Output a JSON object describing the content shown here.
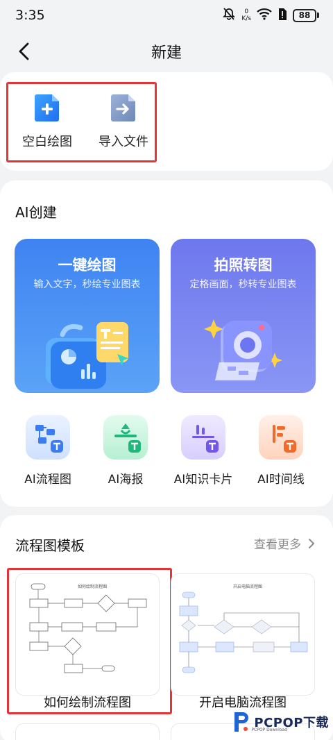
{
  "status": {
    "time": "3:35",
    "net_value": "0",
    "net_unit": "K/s",
    "battery": "88"
  },
  "nav": {
    "title": "新建"
  },
  "quick_actions": [
    {
      "label": "空白绘图",
      "icon": "blank-file-plus-icon"
    },
    {
      "label": "导入文件",
      "icon": "import-file-arrow-icon"
    }
  ],
  "ai_section": {
    "title": "AI创建",
    "cards": [
      {
        "title": "一键绘图",
        "desc": "输入文字，秒绘专业图表"
      },
      {
        "title": "拍照转图",
        "desc": "定格画面，秒转专业图表"
      }
    ],
    "tools": [
      {
        "label": "AI流程图",
        "icon": "ai-flowchart-icon"
      },
      {
        "label": "AI海报",
        "icon": "ai-poster-icon"
      },
      {
        "label": "AI知识卡片",
        "icon": "ai-knowledge-card-icon"
      },
      {
        "label": "AI时间线",
        "icon": "ai-timeline-icon"
      }
    ]
  },
  "flow_section": {
    "title": "流程图模板",
    "more": "查看更多",
    "templates": [
      {
        "label": "如何绘制流程图",
        "thumb_title": "如何绘制流程图"
      },
      {
        "label": "开启电脑流程图",
        "thumb_title": "开启电脑流程图"
      }
    ]
  },
  "watermark": {
    "text": "PCPOP下载",
    "sub": "PCPOP Download"
  },
  "colors": {
    "highlight": "#e0363a",
    "ai_card_1": "#3f83f2",
    "ai_card_2": "#6e78ee",
    "background": "#f2f3f5"
  }
}
